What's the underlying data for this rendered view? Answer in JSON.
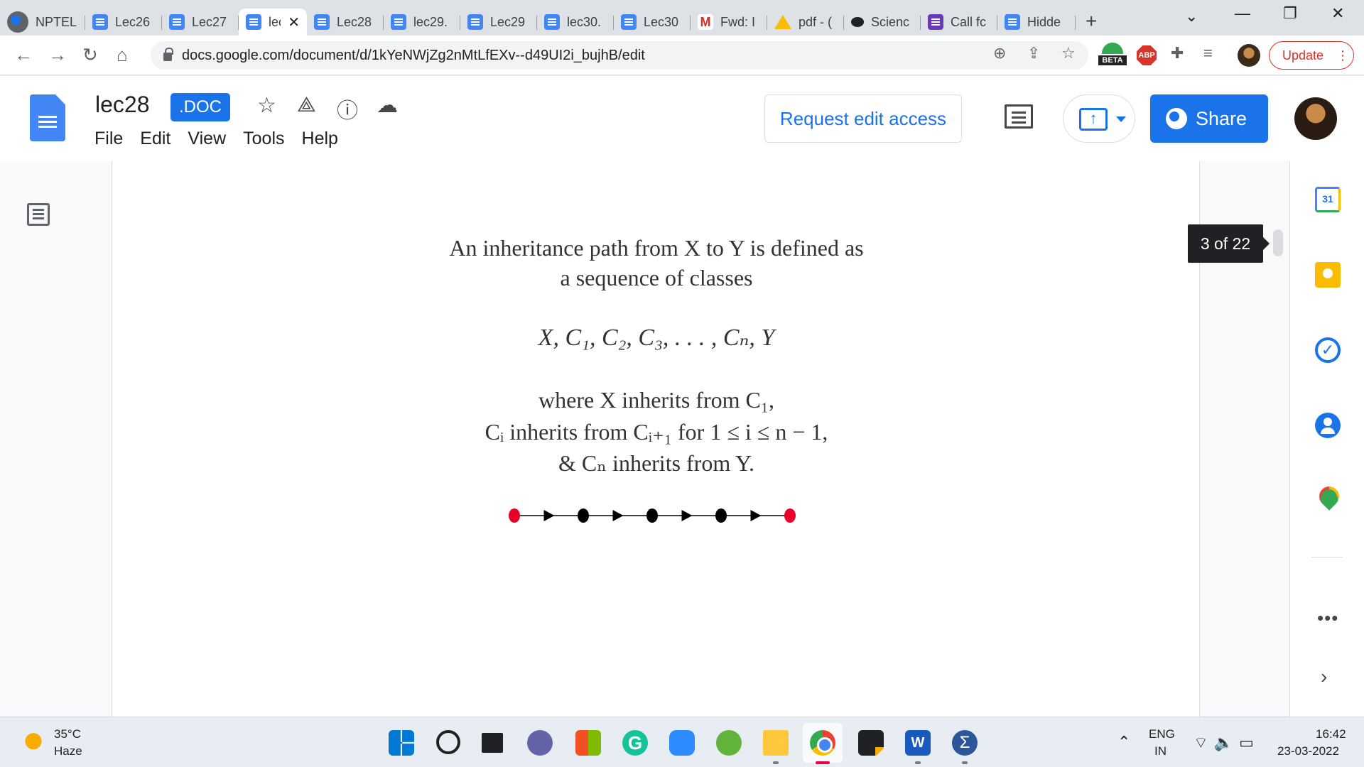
{
  "browser": {
    "tabs": [
      {
        "title": "NPTEL",
        "icon": "globe-icon"
      },
      {
        "title": "Lec26",
        "icon": "docs-icon"
      },
      {
        "title": "Lec27",
        "icon": "docs-icon"
      },
      {
        "title": "lec",
        "icon": "docs-icon",
        "active": true
      },
      {
        "title": "Lec28",
        "icon": "docs-icon"
      },
      {
        "title": "lec29.",
        "icon": "docs-icon"
      },
      {
        "title": "Lec29",
        "icon": "docs-icon"
      },
      {
        "title": "lec30.",
        "icon": "docs-icon"
      },
      {
        "title": "Lec30",
        "icon": "docs-icon"
      },
      {
        "title": "Fwd: I",
        "icon": "gmail-icon"
      },
      {
        "title": "pdf - (",
        "icon": "drive-icon"
      },
      {
        "title": "Scienc",
        "icon": "chat-icon"
      },
      {
        "title": "Call fc",
        "icon": "forms-icon"
      },
      {
        "title": "Hidde",
        "icon": "docs-icon"
      }
    ],
    "tab_close": "✕",
    "new_tab": "+",
    "url": "docs.google.com/document/d/1kYeNWjZg2nMtLfEXv--d49UI2i_bujhB/edit",
    "beta_label": "BETA",
    "abp_label": "ABP",
    "update_label": "Update"
  },
  "docs": {
    "title": "lec28",
    "badge": ".DOC",
    "menu": [
      "File",
      "Edit",
      "View",
      "Tools",
      "Help"
    ],
    "request_edit": "Request edit access",
    "share_label": "Share",
    "page_indicator": "3 of 22"
  },
  "slide": {
    "line1": "An inheritance path from X to Y is defined as",
    "line2": "a sequence of classes",
    "sequence": "X, C₁, C₂, C₃, . . . , Cₙ, Y",
    "cond1": "where X inherits from C₁,",
    "cond2": "Cᵢ inherits from Cᵢ₊₁ for 1 ≤ i ≤ n − 1,",
    "cond3": "& Cₙ inherits from Y.",
    "path_nodes": [
      {
        "color": "#e8002a"
      },
      {
        "color": "#000000"
      },
      {
        "color": "#000000"
      },
      {
        "color": "#000000"
      },
      {
        "color": "#e8002a"
      }
    ]
  },
  "sidepanel": {
    "calendar_day": "31",
    "more": "•••",
    "expand": "›"
  },
  "taskbar": {
    "temperature": "35°C",
    "weather": "Haze",
    "word_letter": "W",
    "grammarly_letter": "G",
    "sigma_letter": "Σ",
    "lang_line1": "ENG",
    "lang_line2": "IN",
    "time": "16:42",
    "date": "23-03-2022"
  }
}
